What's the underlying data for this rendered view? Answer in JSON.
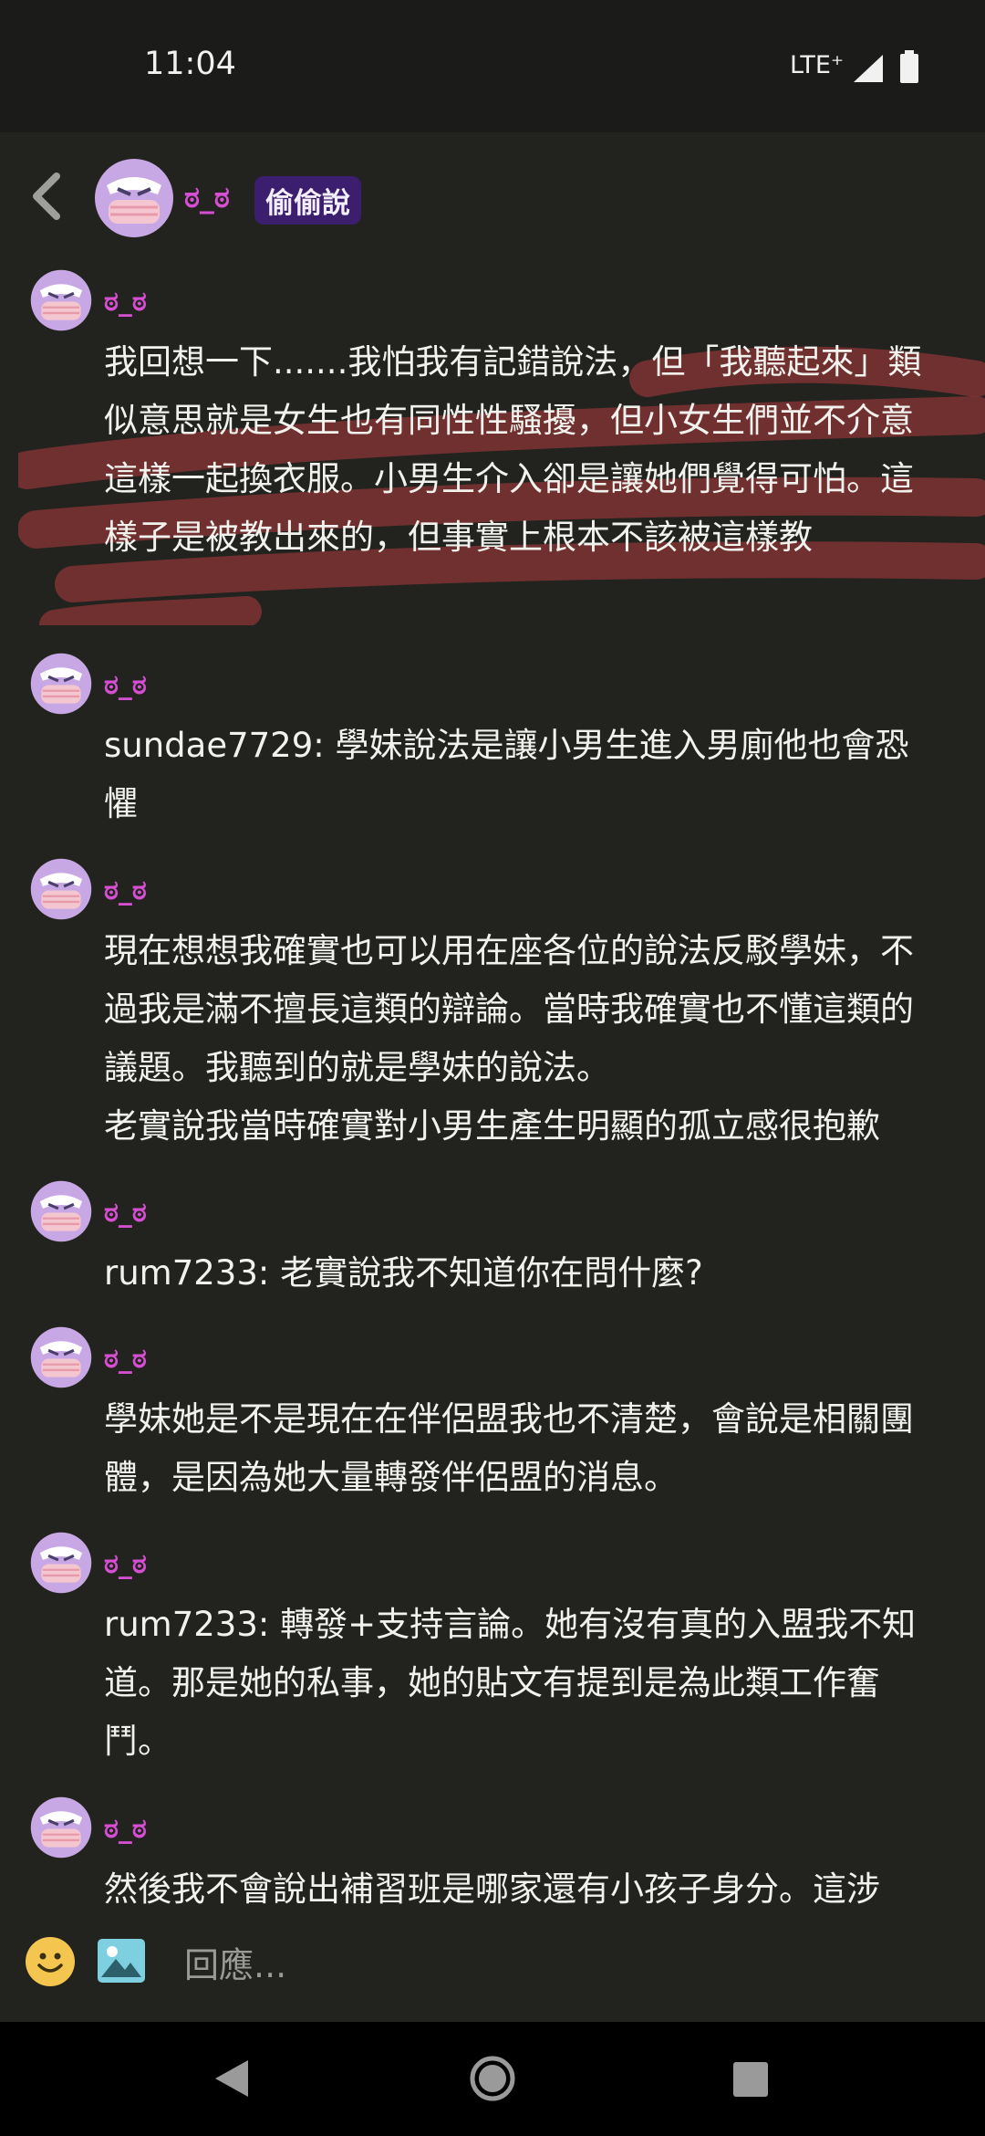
{
  "status_bar": {
    "time": "11:04",
    "network": "LTE⁺"
  },
  "header": {
    "user_name": "ಠ_ಠ",
    "badge": "偷偷說"
  },
  "messages": [
    {
      "author": "ಠ_ಠ",
      "text": "我回想一下.......我怕我有記錯說法，但「我聽起來」類似意思就是女生也有同性性騷擾，但小女生們並不介意這樣一起換衣服。小男生介入卻是讓她們覺得可怕。這樣子是被教出來的，但事實上根本不該被這樣教"
    },
    {
      "author": "ಠ_ಠ",
      "text": "sundae7729: 學妹說法是讓小男生進入男廁他也會恐懼"
    },
    {
      "author": "ಠ_ಠ",
      "line1": "現在想想我確實也可以用在座各位的說法反駁學妹，不過我是滿不擅長這類的辯論。當時我確實也不懂這類的議題。我聽到的就是學妹的說法。",
      "line2": "老實說我當時確實對小男生產生明顯的孤立感很抱歉"
    },
    {
      "author": "ಠ_ಠ",
      "text": "rum7233: 老實說我不知道你在問什麼?"
    },
    {
      "author": "ಠ_ಠ",
      "text": "學妹她是不是現在在伴侶盟我也不清楚，會說是相關團體，是因為她大量轉發伴侶盟的消息。"
    },
    {
      "author": "ಠ_ಠ",
      "text": "rum7233: 轉發+支持言論。她有沒有真的入盟我不知道。那是她的私事，她的貼文有提到是為此類工作奮鬥。"
    },
    {
      "author": "ಠ_ಠ",
      "text": "然後我不會說出補習班是哪家還有小孩子身分。這涉"
    }
  ],
  "composer": {
    "placeholder": "回應..."
  },
  "colors": {
    "accent_name": "#d64fd3",
    "badge_bg": "#3c1e6f",
    "background": "#22231f",
    "scribble": "#8a3535"
  },
  "icons": [
    "back-icon",
    "smiley-icon",
    "image-icon",
    "nav-back-icon",
    "nav-home-icon",
    "nav-recent-icon"
  ]
}
